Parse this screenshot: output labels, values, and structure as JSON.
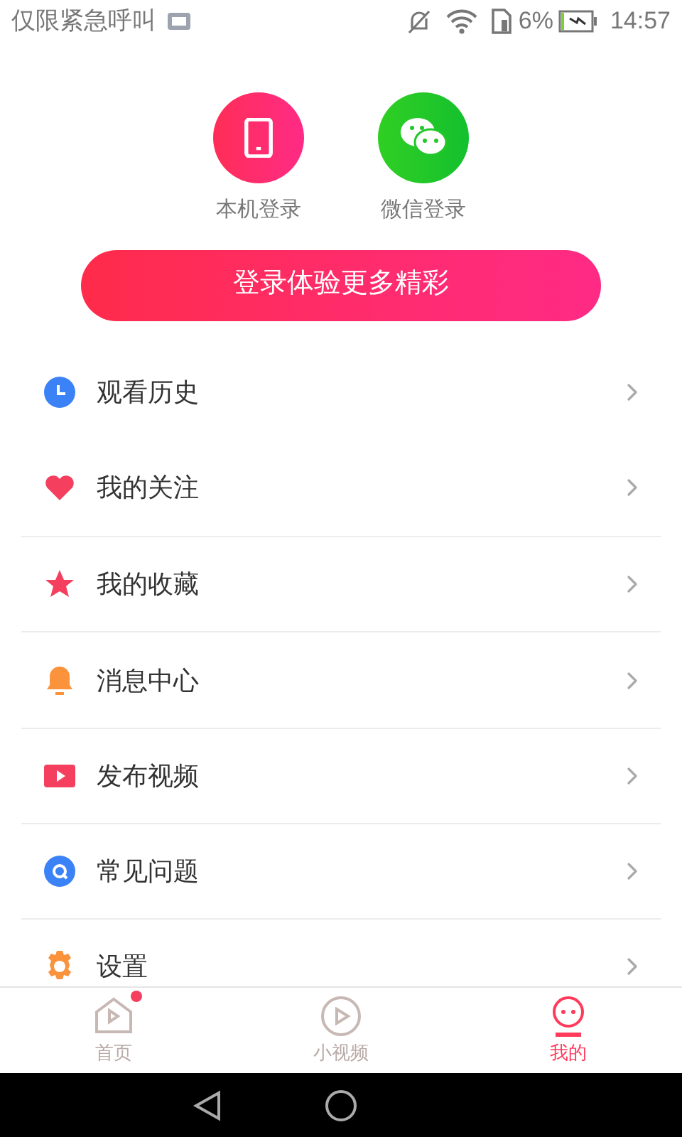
{
  "status_bar": {
    "carrier": "仅限紧急呼叫",
    "battery": "6%",
    "time": "14:57"
  },
  "login_options": [
    {
      "kind": "phone",
      "label": "本机登录"
    },
    {
      "kind": "wechat",
      "label": "微信登录"
    }
  ],
  "login_button": "登录体验更多精彩",
  "menu": [
    {
      "kind": "clock",
      "label": "观看历史"
    },
    {
      "kind": "heart",
      "label": "我的关注"
    },
    {
      "kind": "star",
      "label": "我的收藏"
    },
    {
      "kind": "bell",
      "label": "消息中心"
    },
    {
      "kind": "video",
      "label": "发布视频"
    },
    {
      "kind": "question",
      "label": "常见问题"
    },
    {
      "kind": "gear",
      "label": "设置"
    }
  ],
  "tabs": [
    {
      "kind": "home",
      "label": "首页",
      "selected": false,
      "badge": true
    },
    {
      "kind": "play",
      "label": "小视频",
      "selected": false,
      "badge": false
    },
    {
      "kind": "face",
      "label": "我的",
      "selected": true,
      "badge": false
    }
  ]
}
